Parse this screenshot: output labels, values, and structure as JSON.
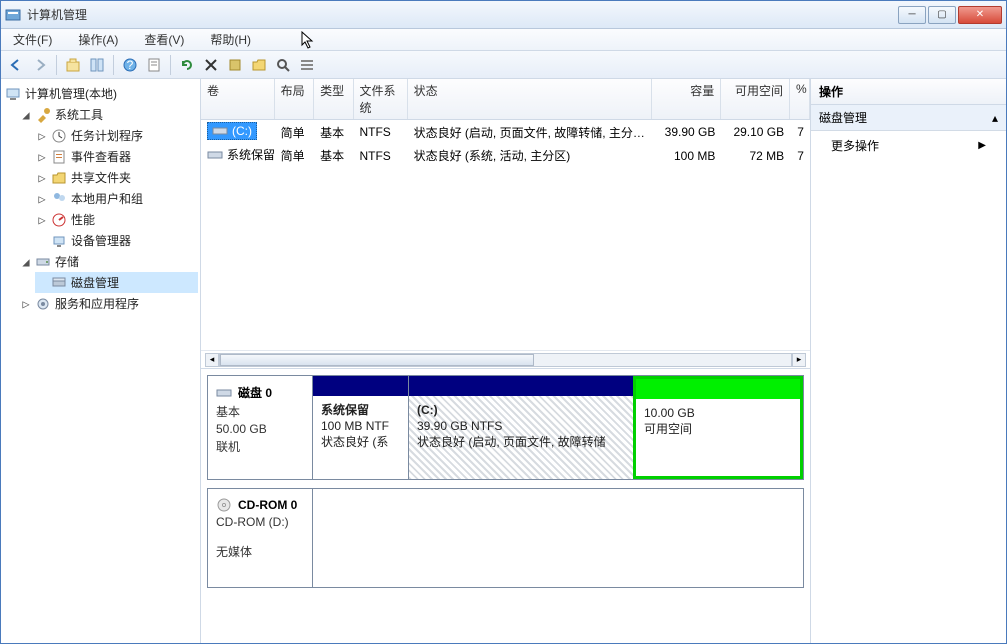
{
  "window": {
    "title": "计算机管理"
  },
  "menus": {
    "file": "文件(F)",
    "action": "操作(A)",
    "view": "查看(V)",
    "help": "帮助(H)"
  },
  "tree": {
    "root": "计算机管理(本地)",
    "system_tools": "系统工具",
    "task_scheduler": "任务计划程序",
    "event_viewer": "事件查看器",
    "shared_folders": "共享文件夹",
    "local_users": "本地用户和组",
    "performance": "性能",
    "device_manager": "设备管理器",
    "storage": "存储",
    "disk_management": "磁盘管理",
    "services_apps": "服务和应用程序"
  },
  "columns": {
    "volume": "卷",
    "layout": "布局",
    "type": "类型",
    "filesystem": "文件系统",
    "status": "状态",
    "capacity": "容量",
    "free": "可用空间",
    "pct": "%"
  },
  "volumes": [
    {
      "name": "(C:)",
      "layout": "简单",
      "type": "基本",
      "fs": "NTFS",
      "status": "状态良好 (启动, 页面文件, 故障转储, 主分区)",
      "capacity": "39.90 GB",
      "free": "29.10 GB",
      "pct": "7",
      "selected": true
    },
    {
      "name": "系统保留",
      "layout": "简单",
      "type": "基本",
      "fs": "NTFS",
      "status": "状态良好 (系统, 活动, 主分区)",
      "capacity": "100 MB",
      "free": "72 MB",
      "pct": "7",
      "selected": false
    }
  ],
  "disk0": {
    "title": "磁盘 0",
    "kind": "基本",
    "size": "50.00 GB",
    "state": "联机",
    "partitions": {
      "reserved": {
        "name": "系统保留",
        "size": "100 MB NTF",
        "status": "状态良好 (系"
      },
      "c": {
        "name": "(C:)",
        "size": "39.90 GB NTFS",
        "status": "状态良好 (启动, 页面文件, 故障转储"
      },
      "free": {
        "size": "10.00 GB",
        "label": "可用空间"
      }
    }
  },
  "cdrom": {
    "title": "CD-ROM 0",
    "drive": "CD-ROM (D:)",
    "state": "无媒体"
  },
  "actions": {
    "header": "操作",
    "section": "磁盘管理",
    "more": "更多操作"
  }
}
